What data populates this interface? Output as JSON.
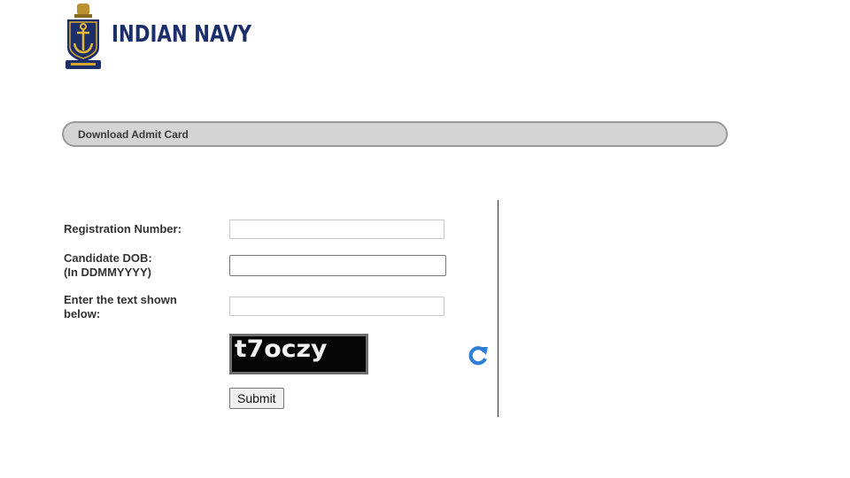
{
  "header": {
    "brand": "INDIAN NAVY",
    "brand_color": "#1c2f6b",
    "emblem_icon": "navy-crest-icon"
  },
  "title_bar": {
    "label": "Download Admit Card"
  },
  "form": {
    "registration": {
      "label": "Registration Number:",
      "value": ""
    },
    "dob": {
      "label_line1": "Candidate DOB:",
      "label_line2": "(In DDMMYYYY)",
      "value": ""
    },
    "captcha_input": {
      "label_line1": "Enter the text shown",
      "label_line2": "below:",
      "value": ""
    },
    "captcha_image_text": "t7oczy",
    "refresh_icon": "refresh-icon",
    "submit_label": "Submit"
  },
  "colors": {
    "bar_fill": "#d4d4d4",
    "refresh_blue": "#2f7fd6"
  }
}
